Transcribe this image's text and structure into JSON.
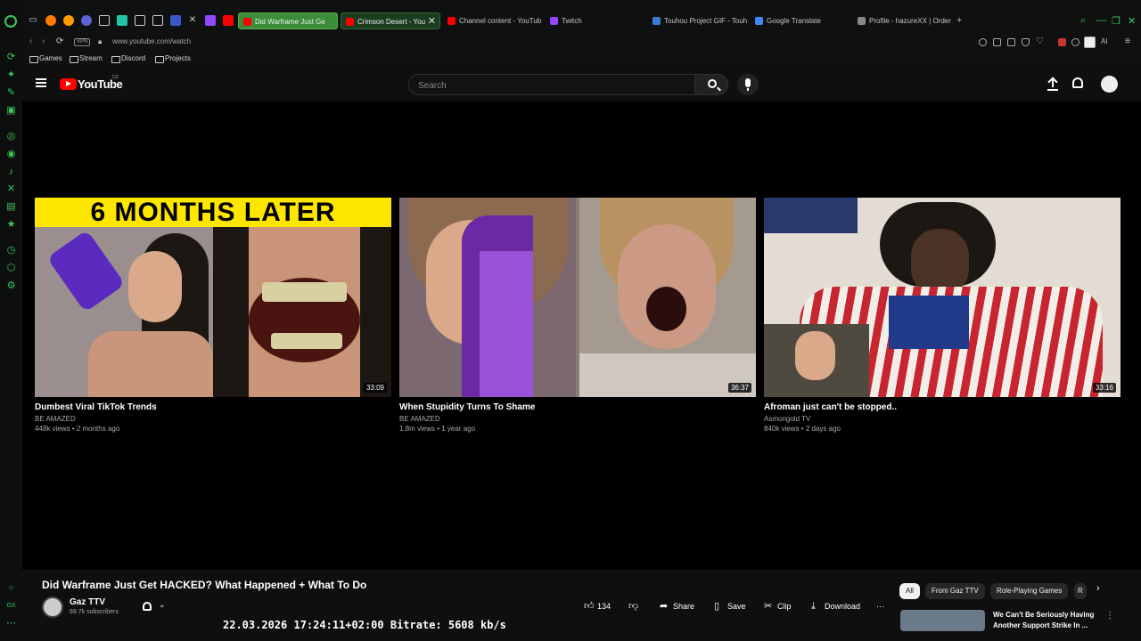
{
  "browser": {
    "tabs": [
      {
        "label": "Did Warframe Just Ge",
        "color": "#ff0000"
      },
      {
        "label": "Crimson Desert - You",
        "color": "#ff0000"
      },
      {
        "label": "Channel content - YouTub",
        "color": "#ff0000"
      },
      {
        "label": "Twitch",
        "color": "#9146ff"
      },
      {
        "label": "Touhou Project GIF - Touh",
        "color": "#3a7bd5"
      },
      {
        "label": "Google Translate",
        "color": "#4285f4"
      },
      {
        "label": "Profile - hazureXX | Order",
        "color": "#888888"
      }
    ],
    "url": "www.youtube.com/watch",
    "vpn_label": "VPN",
    "ai_label": "AI",
    "bookmarks": [
      "Games",
      "Stream",
      "Discord",
      "Projects"
    ]
  },
  "youtube": {
    "logo_text": "YouTube",
    "country_code": "CZ",
    "search_placeholder": "Search"
  },
  "endscreen": [
    {
      "title": "Dumbest Viral TikTok Trends",
      "channel": "BE AMAZED",
      "meta": "448k views • 2 months ago",
      "duration": "33:09",
      "banner": "6 MONTHS LATER"
    },
    {
      "title": "When Stupidity Turns To Shame",
      "channel": "BE AMAZED",
      "meta": "1.8m views • 1 year ago",
      "duration": "36:37"
    },
    {
      "title": "Afroman just can't be stopped..",
      "channel": "Asmongold TV",
      "meta": "840k views • 2 days ago",
      "duration": "33:16"
    }
  ],
  "video": {
    "title": "Did Warframe Just Get HACKED? What Happened + What To Do",
    "channel": "Gaz TTV",
    "subscribers": "69.7k subscribers",
    "likes": "134",
    "actions": {
      "share": "Share",
      "save": "Save",
      "clip": "Clip",
      "download": "Download"
    },
    "overlay": "22.03.2026 17:24:11+02:00 Bitrate: 5608 kb/s"
  },
  "chips": [
    "All",
    "From Gaz TTV",
    "Role-Playing Games",
    "R"
  ],
  "sidebar_video": {
    "title": "We Can't Be Seriously Having Another Support Strike In ..."
  }
}
